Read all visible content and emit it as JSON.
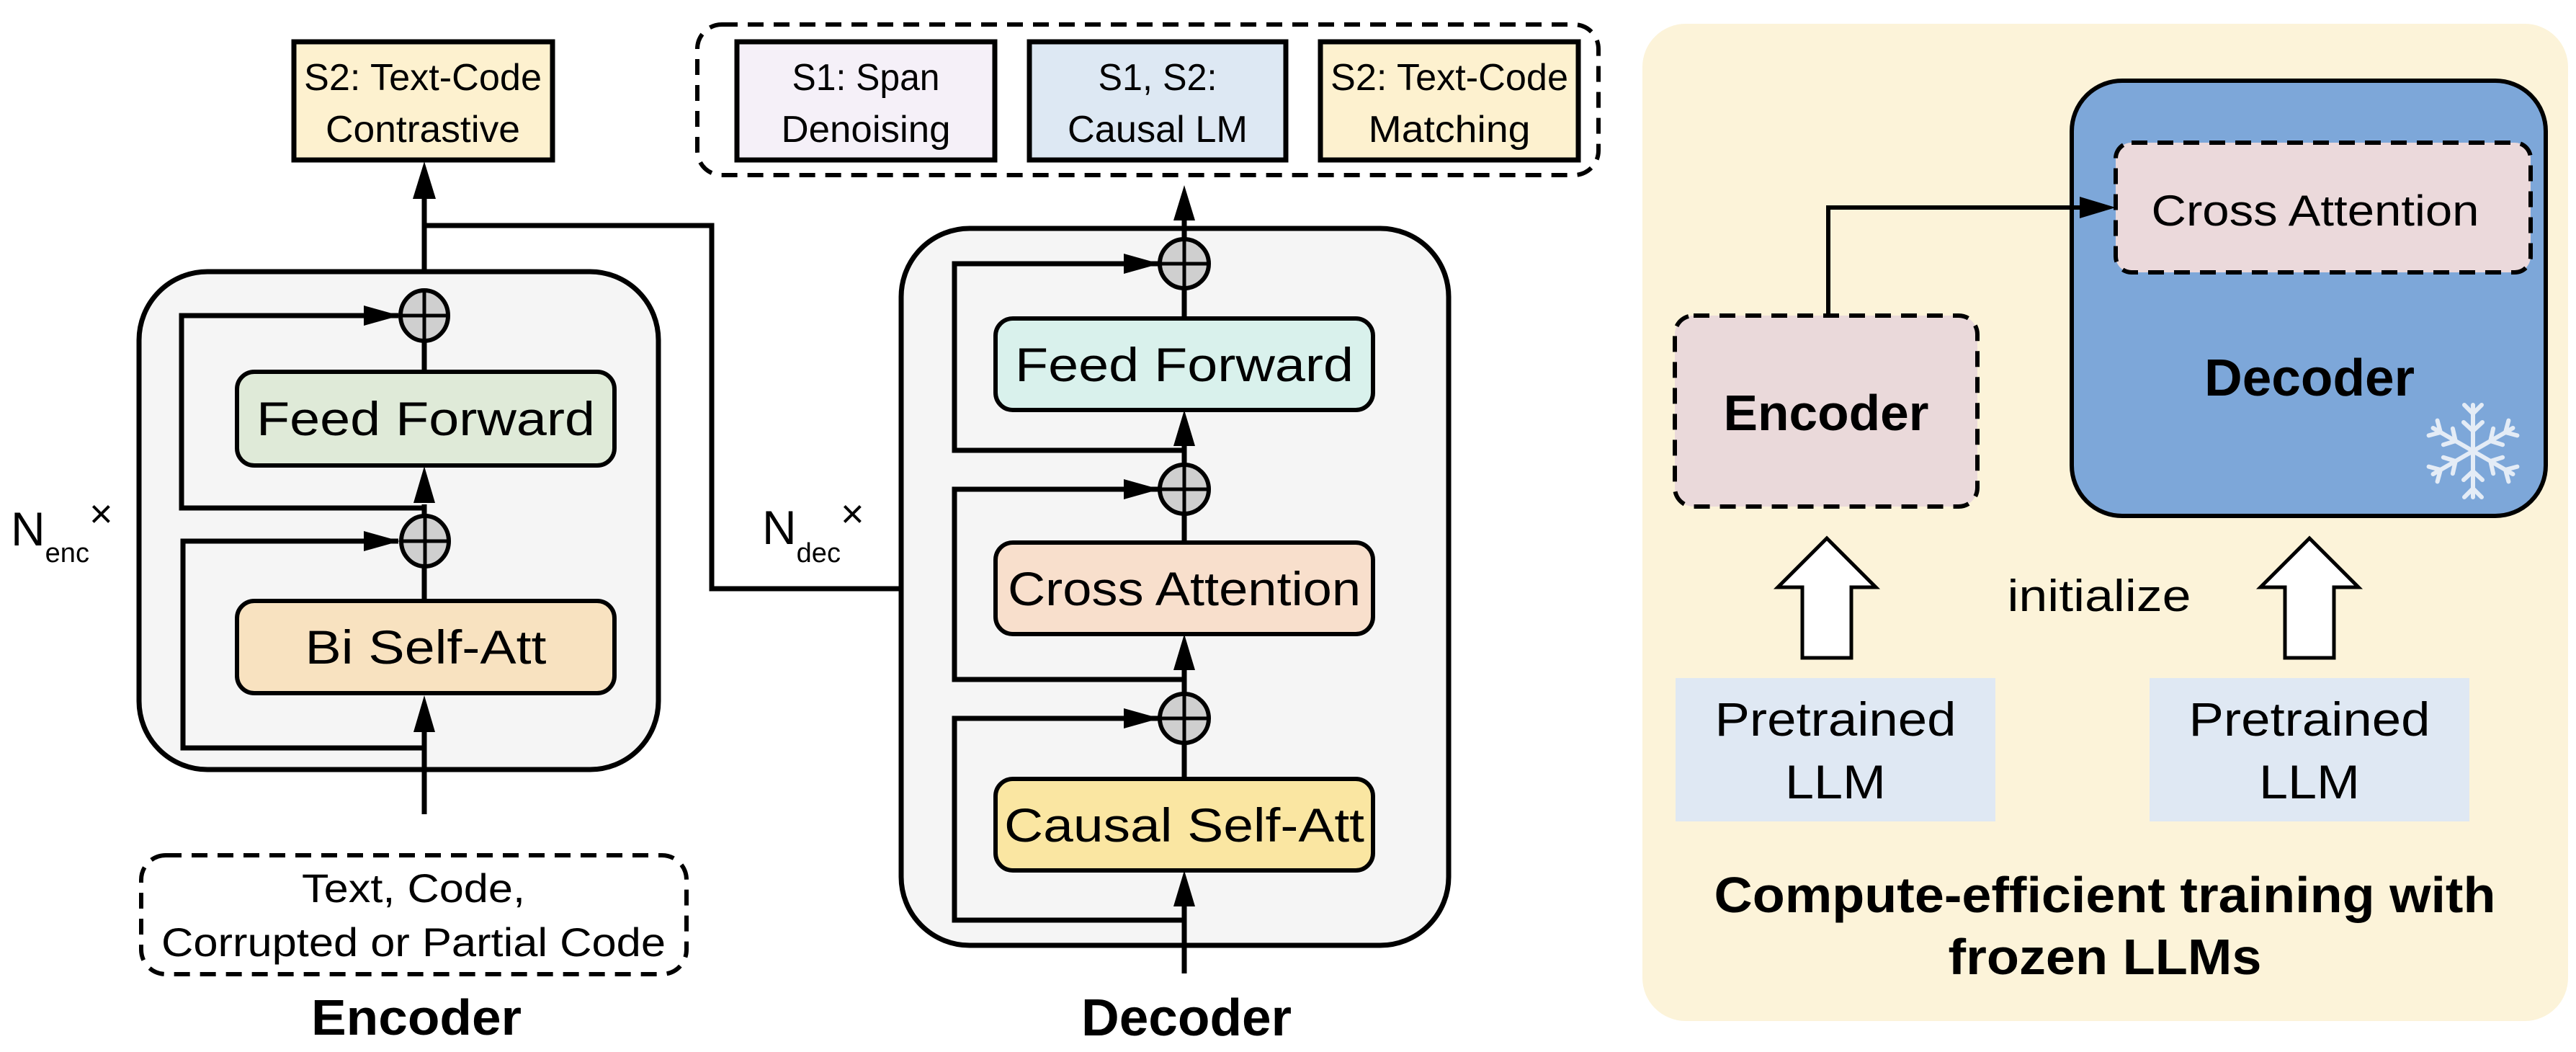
{
  "figure": {
    "type": "encoder-decoder architecture diagram"
  },
  "left": {
    "objective_contrastive": [
      "S2: Text-Code",
      "Contrastive"
    ],
    "objectives_group": [
      {
        "lines": [
          "S1: Span",
          "Denoising"
        ],
        "color": "#f5f0f8"
      },
      {
        "lines": [
          "S1, S2:",
          "Causal LM"
        ],
        "color": "#dde8f3"
      },
      {
        "lines": [
          "S2: Text-Code",
          "Matching"
        ],
        "color": "#fdf1cf"
      }
    ],
    "encoder": {
      "repeat_base": "N",
      "repeat_sub": "enc",
      "repeat_times": "×",
      "layers": [
        {
          "label": "Feed Forward",
          "color": "#dfead8"
        },
        {
          "label": "Bi Self-Att",
          "color": "#f8e2c0"
        }
      ],
      "input_lines": [
        "Text, Code,",
        "Corrupted or Partial Code"
      ],
      "caption": "Encoder"
    },
    "decoder": {
      "repeat_base": "N",
      "repeat_sub": "dec",
      "repeat_times": "×",
      "layers": [
        {
          "label": "Feed Forward",
          "color": "#d9f1ec"
        },
        {
          "label": "Cross Attention",
          "color": "#f8dfcc"
        },
        {
          "label": "Causal Self-Att",
          "color": "#fae6a2"
        }
      ],
      "caption": "Decoder"
    },
    "colors": {
      "block_bg": "#f5f5f5",
      "contrastive_box": "#fdf1cf",
      "add_node": "#cfcfcf"
    }
  },
  "right_panel": {
    "encoder_label": "Encoder",
    "decoder_label": "Decoder",
    "cross_attention_label": "Cross Attention",
    "initialize_label": "initialize",
    "pretrained_left": [
      "Pretrained",
      "LLM"
    ],
    "pretrained_right": [
      "Pretrained",
      "LLM"
    ],
    "caption_lines": [
      "Compute-efficient training with",
      "frozen LLMs"
    ],
    "frozen_icon": "snowflake-icon",
    "colors": {
      "panel_bg": "#fcf3d9",
      "decoder_fill": "#7da7d9",
      "encoder_fill": "#ead9da",
      "cross_attention_fill": "#ebd9db",
      "pretrained_fill": "#dfe8f3",
      "snowflake": "#e4ecf6"
    }
  }
}
